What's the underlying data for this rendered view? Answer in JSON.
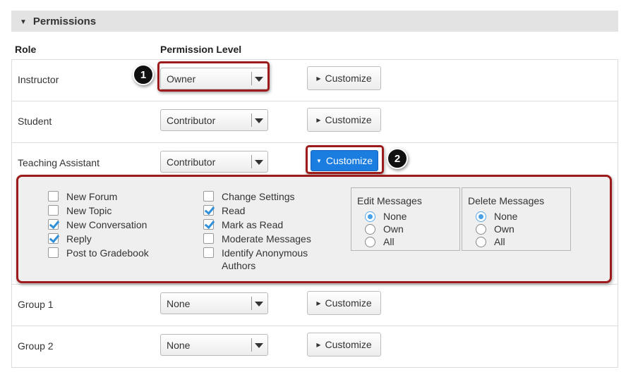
{
  "section": {
    "title": "Permissions"
  },
  "columns": {
    "role": "Role",
    "level": "Permission Level"
  },
  "rows": [
    {
      "role": "Instructor",
      "level": "Owner",
      "button": "Customize"
    },
    {
      "role": "Student",
      "level": "Contributor",
      "button": "Customize"
    },
    {
      "role": "Teaching Assistant",
      "level": "Contributor",
      "button": "Customize"
    },
    {
      "role": "Group 1",
      "level": "None",
      "button": "Customize"
    },
    {
      "role": "Group 2",
      "level": "None",
      "button": "Customize"
    }
  ],
  "callouts": [
    "1",
    "2"
  ],
  "customize": {
    "col1": [
      {
        "label": "New Forum",
        "checked": false
      },
      {
        "label": "New Topic",
        "checked": false
      },
      {
        "label": "New Conversation",
        "checked": true
      },
      {
        "label": "Reply",
        "checked": true
      },
      {
        "label": "Post to Gradebook",
        "checked": false
      }
    ],
    "col2": [
      {
        "label": "Change Settings",
        "checked": false
      },
      {
        "label": "Read",
        "checked": true
      },
      {
        "label": "Mark as Read",
        "checked": true
      },
      {
        "label": "Moderate Messages",
        "checked": false
      },
      {
        "label": "Identify Anonymous",
        "label2": "Authors",
        "checked": false
      }
    ],
    "edit": {
      "legend": "Edit Messages",
      "options": [
        "None",
        "Own",
        "All"
      ],
      "selected": "None"
    },
    "delete": {
      "legend": "Delete Messages",
      "options": [
        "None",
        "Own",
        "All"
      ],
      "selected": "None"
    }
  },
  "colors": {
    "accent": "#1a7ddf",
    "highlight": "#9e1b1b",
    "check": "#2f8fd8"
  }
}
